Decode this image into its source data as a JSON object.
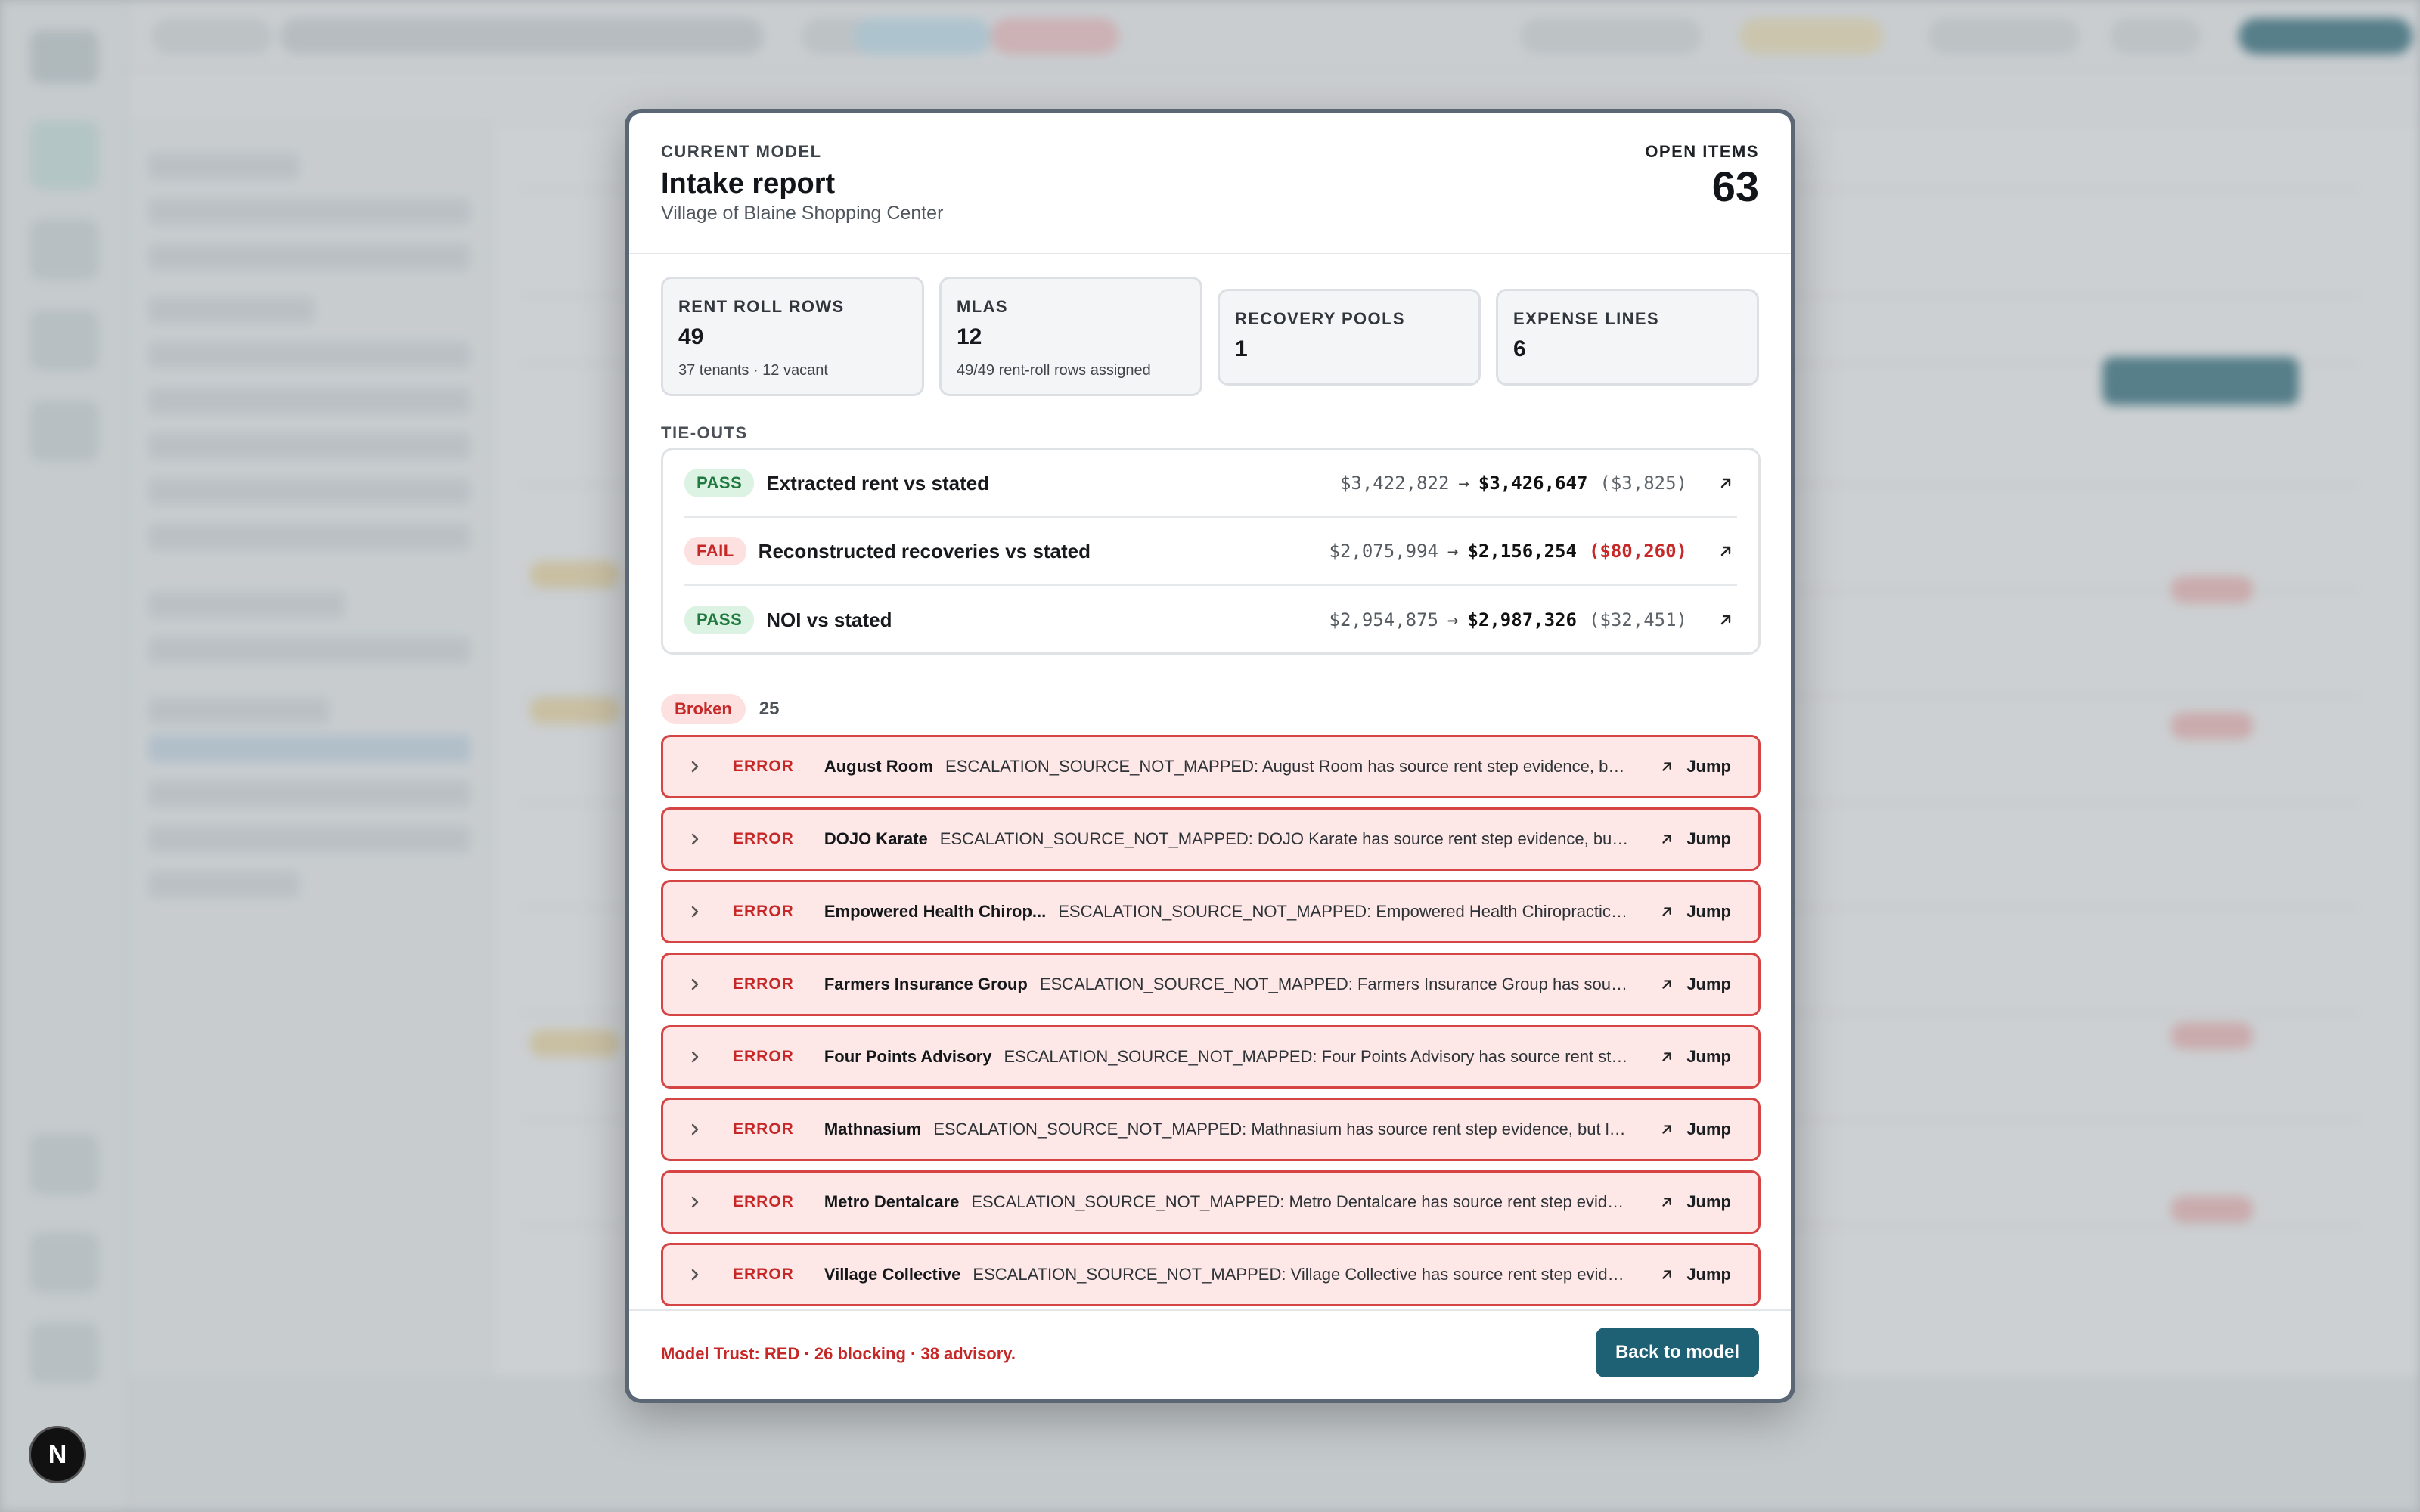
{
  "modal": {
    "overline": "CURRENT MODEL",
    "title": "Intake report",
    "subtitle": "Village of Blaine Shopping Center",
    "open_items_label": "OPEN ITEMS",
    "open_items_value": "63"
  },
  "stats": [
    {
      "label": "RENT ROLL ROWS",
      "value": "49",
      "detail": "37 tenants · 12 vacant"
    },
    {
      "label": "MLAS",
      "value": "12",
      "detail": "49/49 rent-roll rows assigned"
    },
    {
      "label": "RECOVERY POOLS",
      "value": "1",
      "detail": ""
    },
    {
      "label": "EXPENSE LINES",
      "value": "6",
      "detail": ""
    }
  ],
  "tieouts_label": "TIE-OUTS",
  "tieouts": [
    {
      "status": "PASS",
      "name": "Extracted rent vs stated",
      "from": "$3,422,822",
      "arrow": "→",
      "to": "$3,426,647",
      "delta": "($3,825)"
    },
    {
      "status": "FAIL",
      "name": "Reconstructed recoveries vs stated",
      "from": "$2,075,994",
      "arrow": "→",
      "to": "$2,156,254",
      "delta": "($80,260)"
    },
    {
      "status": "PASS",
      "name": "NOI vs stated",
      "from": "$2,954,875",
      "arrow": "→",
      "to": "$2,987,326",
      "delta": "($32,451)"
    }
  ],
  "broken": {
    "label": "Broken",
    "count": "25"
  },
  "errors": [
    {
      "level": "ERROR",
      "name": "August Room",
      "message": "ESCALATION_SOURCE_NOT_MAPPED: August Room has source rent step evidence, but l...",
      "action": "Jump"
    },
    {
      "level": "ERROR",
      "name": "DOJO Karate",
      "message": "ESCALATION_SOURCE_NOT_MAPPED: DOJO Karate has source rent step evidence, but le...",
      "action": "Jump"
    },
    {
      "level": "ERROR",
      "name": "Empowered Health Chirop...",
      "message": "ESCALATION_SOURCE_NOT_MAPPED: Empowered Health Chiropractic ha...",
      "action": "Jump"
    },
    {
      "level": "ERROR",
      "name": "Farmers Insurance Group",
      "message": "ESCALATION_SOURCE_NOT_MAPPED: Farmers Insurance Group has source ...",
      "action": "Jump"
    },
    {
      "level": "ERROR",
      "name": "Four Points Advisory",
      "message": "ESCALATION_SOURCE_NOT_MAPPED: Four Points Advisory has source rent step ...",
      "action": "Jump"
    },
    {
      "level": "ERROR",
      "name": "Mathnasium",
      "message": "ESCALATION_SOURCE_NOT_MAPPED: Mathnasium has source rent step evidence, but lea...",
      "action": "Jump"
    },
    {
      "level": "ERROR",
      "name": "Metro Dentalcare",
      "message": "ESCALATION_SOURCE_NOT_MAPPED: Metro Dentalcare has source rent step eviden...",
      "action": "Jump"
    },
    {
      "level": "ERROR",
      "name": "Village Collective",
      "message": "ESCALATION_SOURCE_NOT_MAPPED: Village Collective has source rent step eviden...",
      "action": "Jump"
    }
  ],
  "footer": {
    "trust": "Model Trust: RED · 26 blocking · 38 advisory.",
    "back_label": "Back to model"
  },
  "app_badge": "N",
  "icons": {
    "external": "arrow-up-right-icon",
    "chevron": "chevron-right-icon"
  },
  "colors": {
    "pass": "#1f7a3f",
    "fail": "#c62828",
    "primary": "#1f6174",
    "error_border": "#d64545"
  }
}
